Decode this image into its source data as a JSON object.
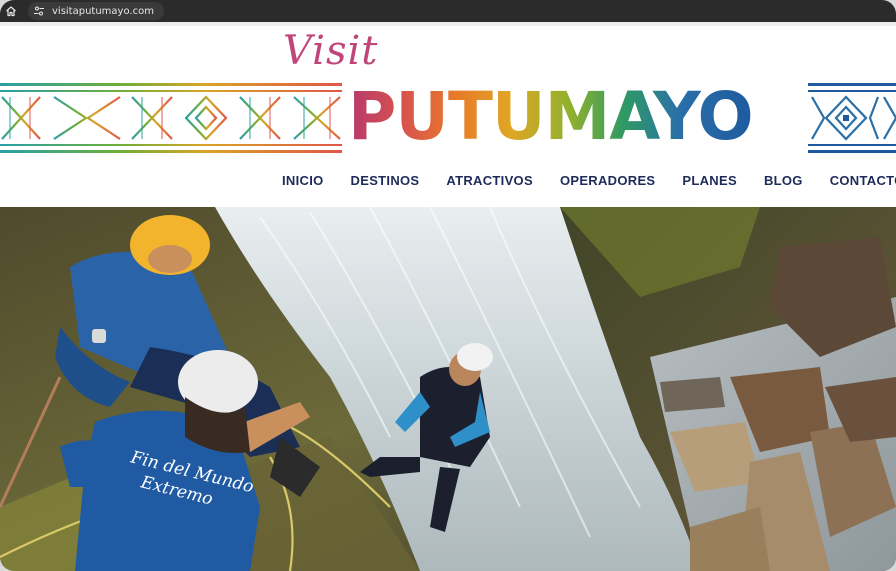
{
  "browser": {
    "url": "visitaputumayo.com",
    "home_icon": "home-icon",
    "site_info_icon": "site-info-icon"
  },
  "logo": {
    "script": "Visit",
    "word": "PUTUMAYO",
    "colors": [
      "#b63a6c",
      "#e8772a",
      "#e0a624",
      "#8fb12e",
      "#2f9a63",
      "#2a6fa8"
    ]
  },
  "nav": {
    "items": [
      {
        "label": "INICIO"
      },
      {
        "label": "DESTINOS"
      },
      {
        "label": "ATRACTIVOS"
      },
      {
        "label": "OPERADORES"
      },
      {
        "label": "PLANES"
      },
      {
        "label": "BLOG"
      },
      {
        "label": "CONTACTO"
      }
    ],
    "color": "#1e2b5a"
  },
  "hero": {
    "shirt_text_1": "Fin del Mundo",
    "shirt_text_2": "Extremo"
  }
}
